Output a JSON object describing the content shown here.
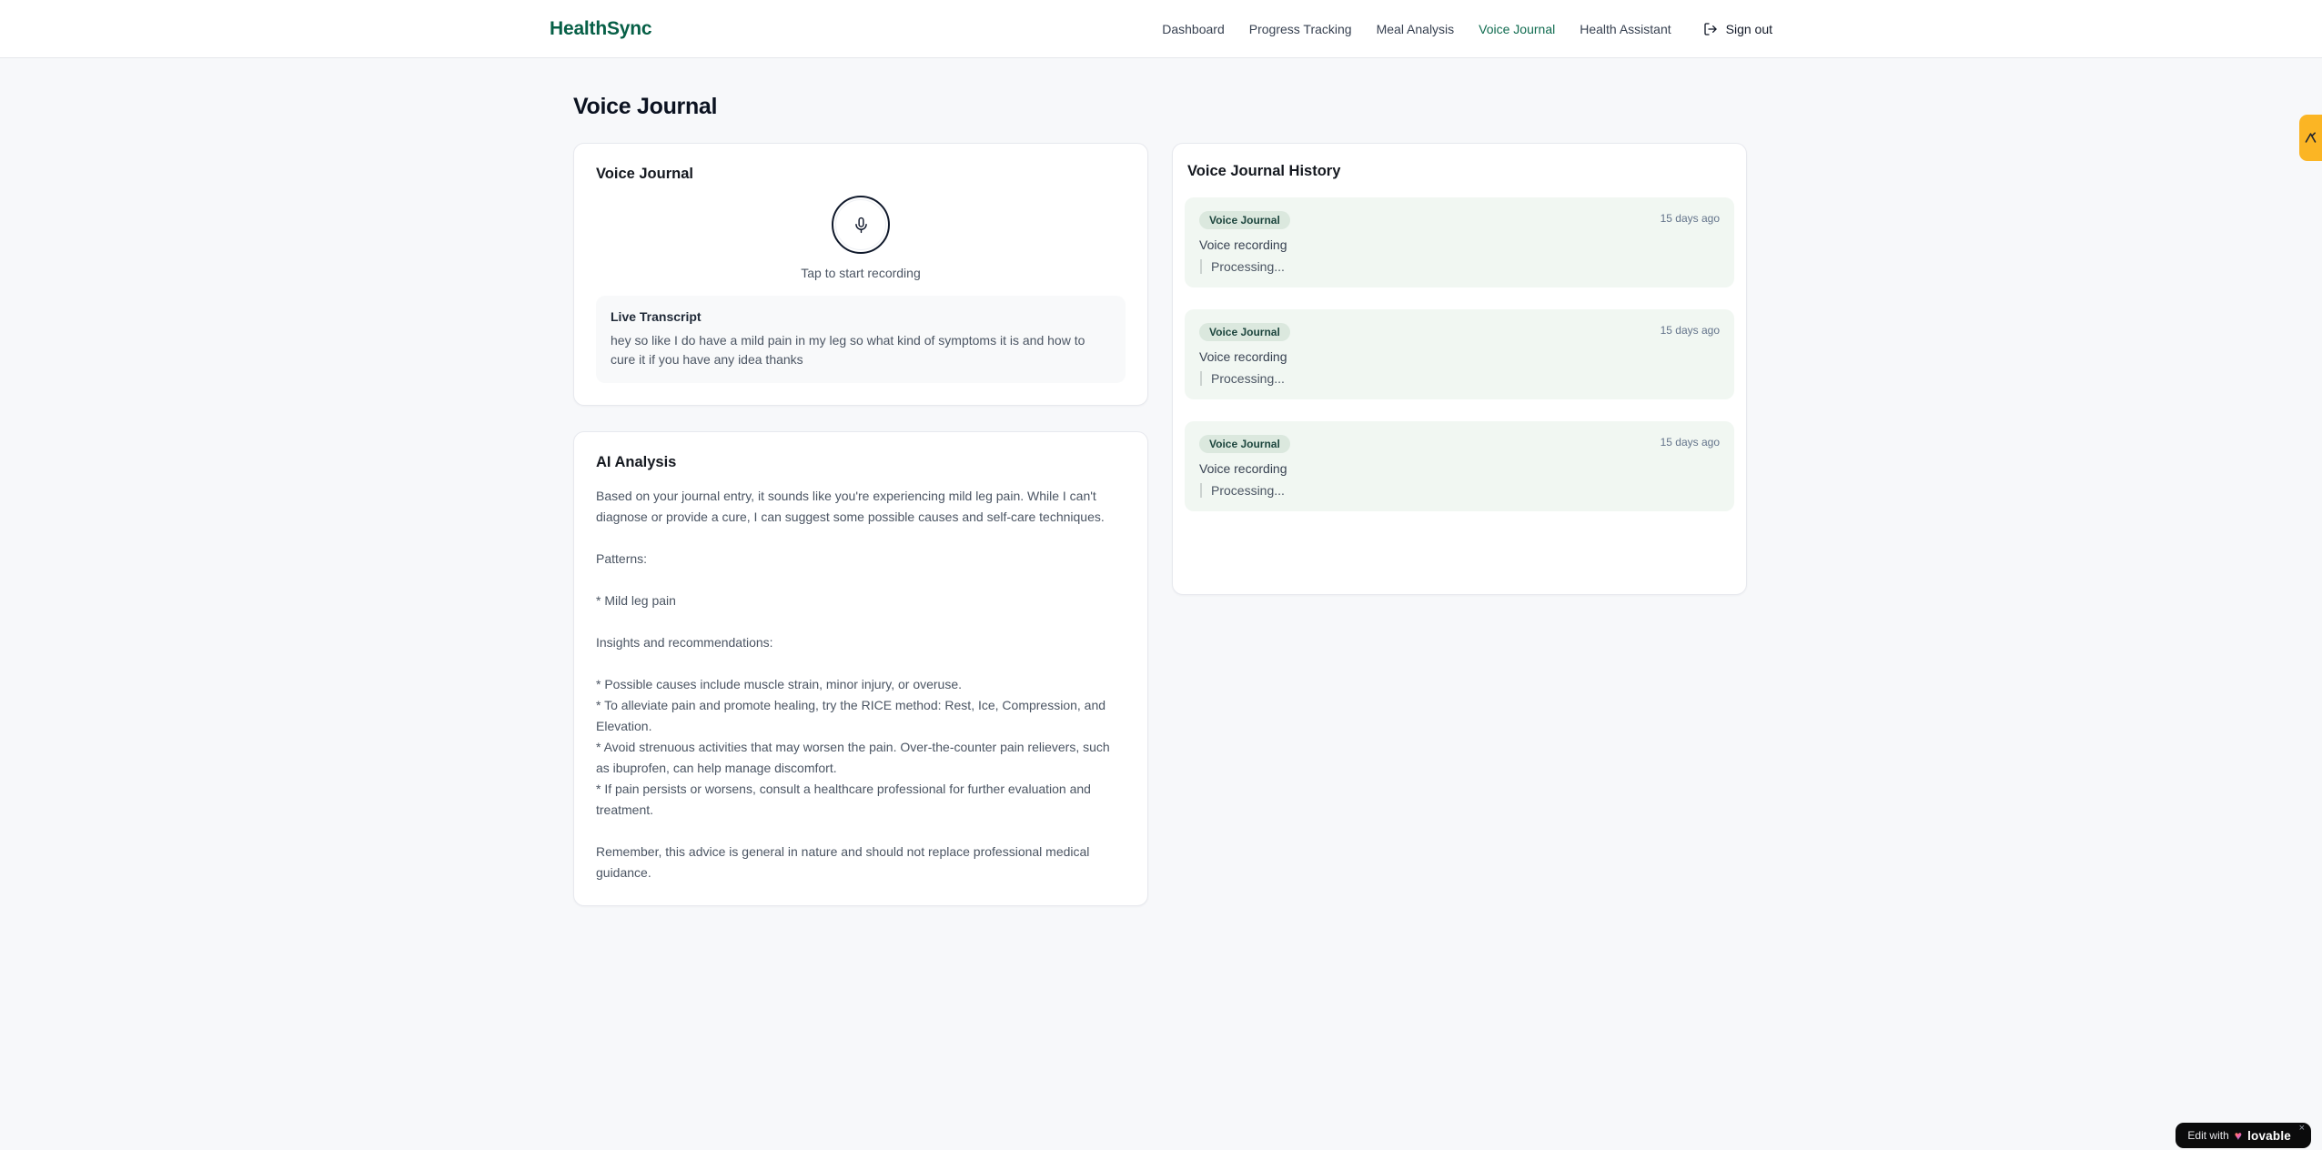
{
  "brand": {
    "name": "HealthSync"
  },
  "nav": {
    "items": [
      {
        "label": "Dashboard",
        "active": false
      },
      {
        "label": "Progress Tracking",
        "active": false
      },
      {
        "label": "Meal Analysis",
        "active": false
      },
      {
        "label": "Voice Journal",
        "active": true
      },
      {
        "label": "Health Assistant",
        "active": false
      }
    ],
    "sign_out_label": "Sign out"
  },
  "page": {
    "title": "Voice Journal"
  },
  "recorder_card": {
    "title": "Voice Journal",
    "tap_label": "Tap to start recording",
    "transcript": {
      "title": "Live Transcript",
      "text": "hey so like I do have a mild pain in my leg so what kind of symptoms it is and how to cure it if you have any idea thanks"
    }
  },
  "analysis_card": {
    "title": "AI Analysis",
    "body": "Based on your journal entry, it sounds like you're experiencing mild leg pain. While I can't diagnose or provide a cure, I can suggest some possible causes and self-care techniques.\n\nPatterns:\n\n* Mild leg pain\n\nInsights and recommendations:\n\n* Possible causes include muscle strain, minor injury, or overuse.\n* To alleviate pain and promote healing, try the RICE method: Rest, Ice, Compression, and Elevation.\n* Avoid strenuous activities that may worsen the pain. Over-the-counter pain relievers, such as ibuprofen, can help manage discomfort.\n* If pain persists or worsens, consult a healthcare professional for further evaluation and treatment.\n\nRemember, this advice is general in nature and should not replace professional medical guidance."
  },
  "history_panel": {
    "title": "Voice Journal History",
    "entries": [
      {
        "badge": "Voice Journal",
        "timestamp": "15 days ago",
        "description": "Voice recording",
        "status": "Processing..."
      },
      {
        "badge": "Voice Journal",
        "timestamp": "15 days ago",
        "description": "Voice recording",
        "status": "Processing..."
      },
      {
        "badge": "Voice Journal",
        "timestamp": "15 days ago",
        "description": "Voice recording",
        "status": "Processing..."
      }
    ]
  },
  "overlays": {
    "lovable_badge": {
      "prefix": "Edit with",
      "heart": "♥",
      "brand": "lovable",
      "close": "×"
    }
  },
  "colors": {
    "brand_green": "#065f46",
    "nav_active_green": "#0f6b4f",
    "entry_background": "#f1f7f2",
    "badge_background": "#dbe8de",
    "badge_text": "#1d463e",
    "side_tab_amber": "#fbb524",
    "lovable_black": "#0b0b0c"
  }
}
